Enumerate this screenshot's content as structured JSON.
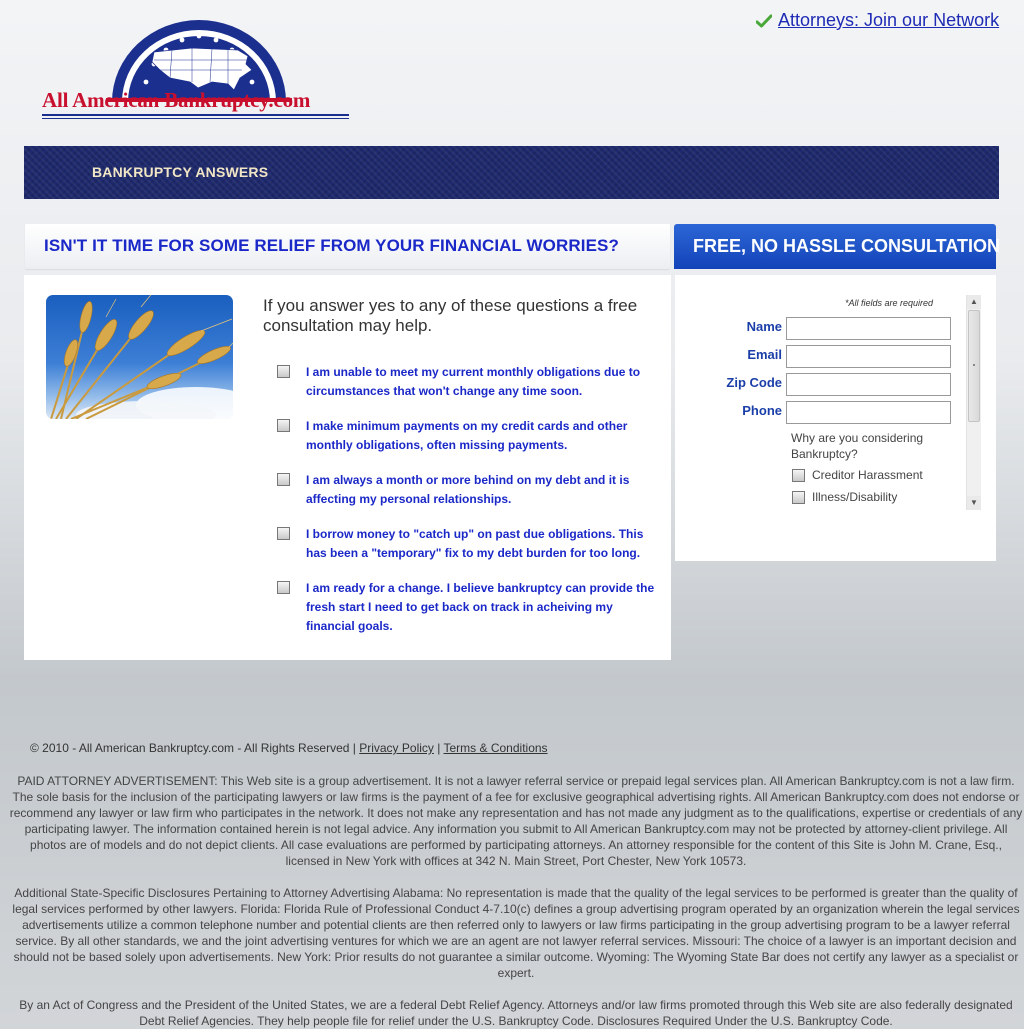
{
  "header": {
    "logo_text": "All American Bankruptcy.com",
    "top_link": "Attorneys: Join our Network"
  },
  "nav": {
    "items": [
      "BANKRUPTCY ANSWERS"
    ]
  },
  "main": {
    "headline": "ISN'T IT TIME FOR SOME RELIEF FROM YOUR FINANCIAL WORRIES?",
    "intro": "If you answer yes to any of these questions a free consultation may help.",
    "questions": [
      "I am unable to meet my current monthly obligations due to circumstances that won't change any time soon.",
      "I make minimum payments on my credit cards and other monthly obligations, often missing payments.",
      "I am always a month or more behind on my debt and it is affecting my personal relationships.",
      "I borrow money to \"catch up\" on past due obligations. This has been a \"temporary\" fix to my debt burden for too long.",
      "I am ready for a change. I believe bankruptcy can provide the fresh start I need to get back on track in acheiving my financial goals."
    ]
  },
  "form": {
    "header": "FREE, NO HASSLE CONSULTATION",
    "required_note": "*All fields are required",
    "fields": [
      {
        "label": "Name",
        "value": ""
      },
      {
        "label": "Email",
        "value": ""
      },
      {
        "label": "Zip Code",
        "value": ""
      },
      {
        "label": "Phone",
        "value": ""
      }
    ],
    "reason_question": "Why are you considering Bankruptcy?",
    "reasons": [
      "Creditor Harassment",
      "Illness/Disability"
    ]
  },
  "footer": {
    "copyright": "© 2010 - All American Bankruptcy.com - All Rights Reserved |",
    "separator": "|",
    "privacy": "Privacy Policy",
    "terms": "Terms & Conditions",
    "paragraphs": [
      "PAID ATTORNEY ADVERTISEMENT: This Web site is a group advertisement. It is not a lawyer referral service or prepaid legal services plan. All American Bankruptcy.com is not a law firm. The sole basis for the inclusion of the participating lawyers or law firms is the payment of a fee for exclusive geographical advertising rights. All American Bankruptcy.com does not endorse or recommend any lawyer or law firm who participates in the network. It does not make any representation and has not made any judgment as to the qualifications, expertise or credentials of any participating lawyer. The information contained herein is not legal advice. Any information you submit to All American Bankruptcy.com may not be protected by attorney-client privilege. All photos are of models and do not depict clients. All case evaluations are performed by participating attorneys. An attorney responsible for the content of this Site is John M. Crane, Esq., licensed in New York with offices at 342 N. Main Street, Port Chester, New York 10573.",
      "Additional State-Specific Disclosures Pertaining to Attorney Advertising Alabama: No representation is made that the quality of the legal services to be performed is greater than the quality of legal services performed by other lawyers. Florida: Florida Rule of Professional Conduct 4-7.10(c) defines a group advertising program operated by an organization wherein the legal services advertisements utilize a common telephone number and potential clients are then referred only to lawyers or law firms participating in the group advertising program to be a lawyer referral service. By all other standards, we and the joint advertising ventures for which we are an agent are not lawyer referral services. Missouri: The choice of a lawyer is an important decision and should not be based solely upon advertisements. New York: Prior results do not guarantee a similar outcome. Wyoming: The Wyoming State Bar does not certify any lawyer as a specialist or expert.",
      "By an Act of Congress and the President of the United States, we are a federal Debt Relief Agency. Attorneys and/or law firms promoted through this Web site are also federally designated Debt Relief Agencies. They help people file for relief under the U.S. Bankruptcy Code. Disclosures Required Under the U.S. Bankruptcy Code."
    ]
  },
  "colors": {
    "accent_blue": "#1b28c8",
    "logo_red": "#c8102e",
    "nav_navy": "#1f2a6e",
    "consult_blue": "#1343b8"
  },
  "icons": [
    "checkmark-icon",
    "us-map-emblem",
    "scroll-up-icon",
    "scroll-down-icon"
  ]
}
